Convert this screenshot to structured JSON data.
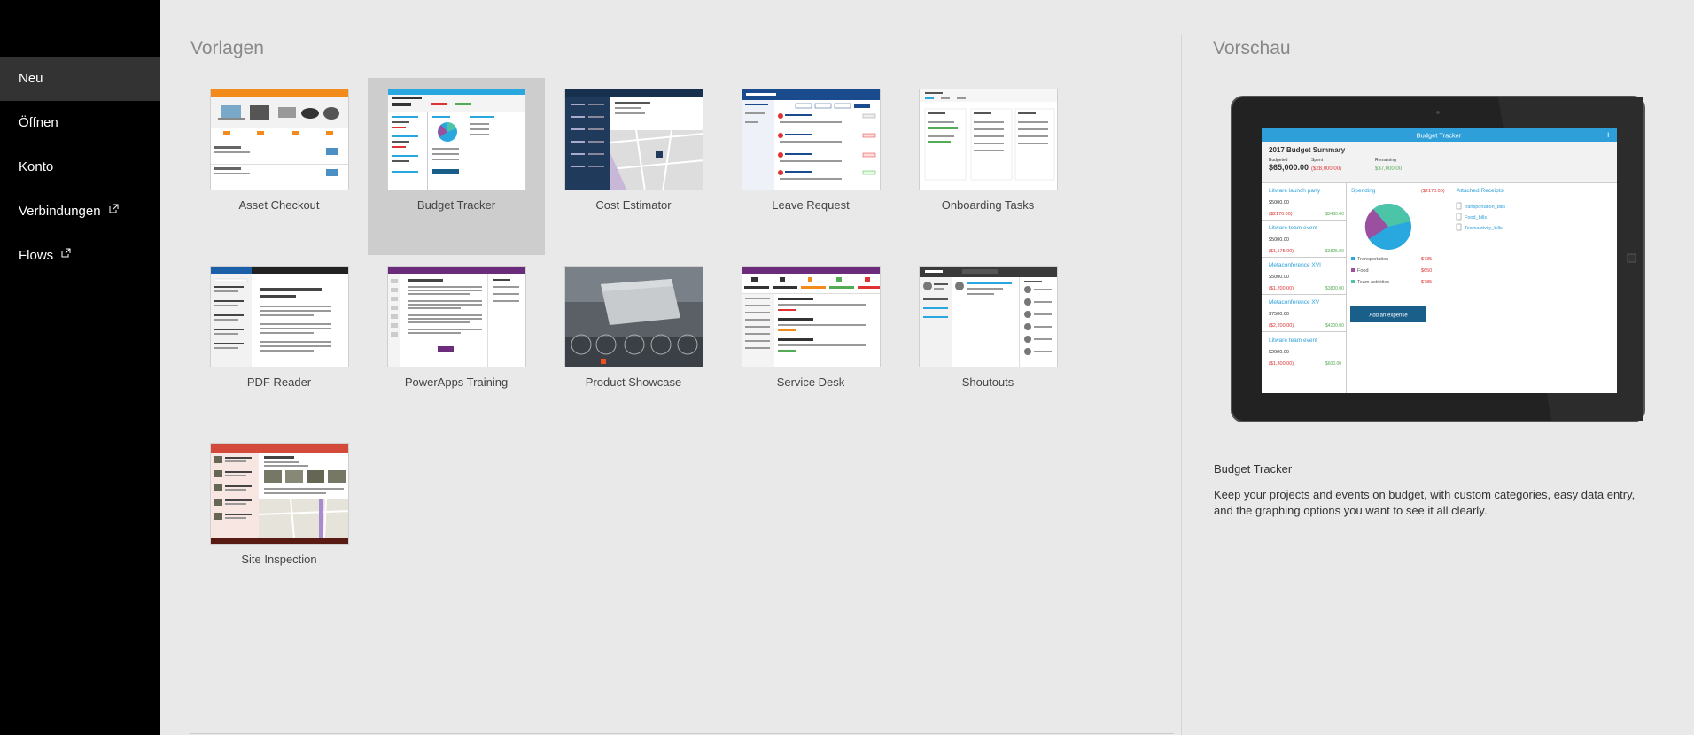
{
  "sidebar": {
    "items": [
      {
        "label": "Neu",
        "active": true
      },
      {
        "label": "Öffnen"
      },
      {
        "label": "Konto"
      },
      {
        "label": "Verbindungen",
        "external": true
      },
      {
        "label": "Flows",
        "external": true
      }
    ]
  },
  "templates": {
    "title": "Vorlagen",
    "items": [
      {
        "label": "Asset Checkout"
      },
      {
        "label": "Budget Tracker",
        "selected": true
      },
      {
        "label": "Cost Estimator"
      },
      {
        "label": "Leave Request"
      },
      {
        "label": "Onboarding Tasks"
      },
      {
        "label": "PDF Reader"
      },
      {
        "label": "PowerApps Training"
      },
      {
        "label": "Product Showcase"
      },
      {
        "label": "Service Desk"
      },
      {
        "label": "Shoutouts"
      },
      {
        "label": "Site Inspection"
      }
    ]
  },
  "preview": {
    "title": "Vorschau",
    "name": "Budget Tracker",
    "description": "Keep your projects and events on budget, with custom categories, easy data entry, and the graphing options you want to see it all clearly.",
    "screen": {
      "app_title": "Budget Tracker",
      "summary_title": "2017 Budget Summary",
      "budgeted_label": "Budgeted",
      "budgeted_value": "$65,000.00",
      "spent_label": "Spent",
      "spent_value": "($28,000.00)",
      "remaining_label": "Remaining",
      "remaining_value": "$37,000.00",
      "events": [
        {
          "name": "Litware launch party",
          "budget": "$5000.00",
          "spent": "($2170.00)",
          "remaining": "$3430.00"
        },
        {
          "name": "Litware team event",
          "budget": "$5000.00",
          "spent": "($1,175.00)",
          "remaining": "$3825.00"
        },
        {
          "name": "Metaconference XVI",
          "budget": "$5000.00",
          "spent": "($1,200.00)",
          "remaining": "$3800.00"
        },
        {
          "name": "Metaconference XV",
          "budget": "$7500.00",
          "spent": "($2,200.00)",
          "remaining": "$4200.00"
        },
        {
          "name": "Litware team event",
          "budget": "$2000.00",
          "spent": "($1,300.00)",
          "remaining": "$600.00"
        }
      ],
      "spending_title": "Spending",
      "spending_total": "($2170.00)",
      "categories": [
        {
          "name": "Transportation",
          "amount": "$735",
          "color": "#29a8e0"
        },
        {
          "name": "Food",
          "amount": "$650",
          "color": "#9b4f9f"
        },
        {
          "name": "Team activities",
          "amount": "$785",
          "color": "#4bc4a8"
        }
      ],
      "add_expense_label": "Add an expense",
      "receipts_title": "Attached Receipts",
      "receipts": [
        "transportation_bills",
        "Food_bills",
        "Teamactivity_bills"
      ]
    }
  },
  "colors": {
    "accent": "#2e9fd8",
    "sidebar_bg": "#000000",
    "selected_tile": "#cdcdcd"
  }
}
